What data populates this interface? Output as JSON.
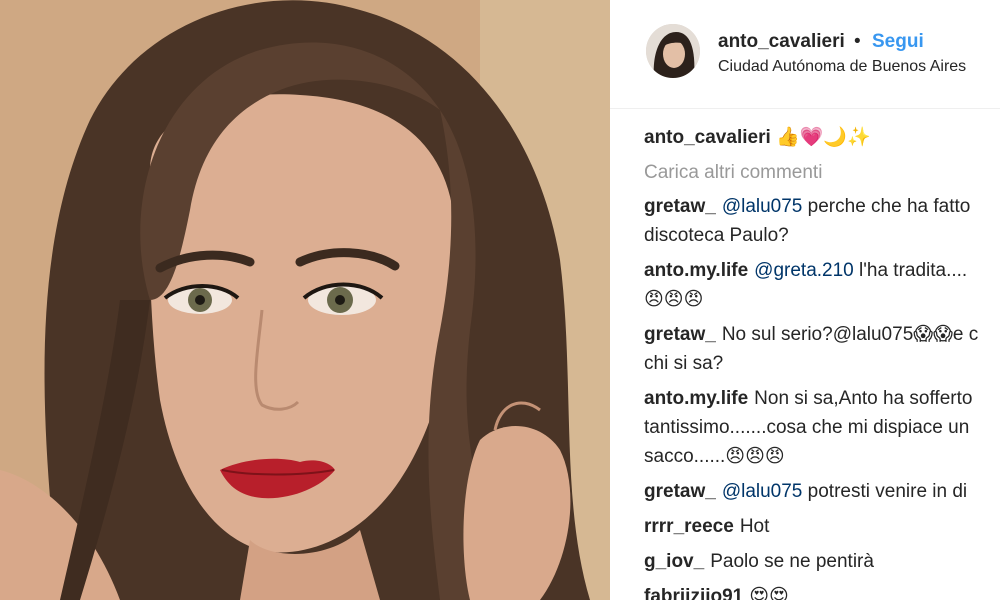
{
  "post": {
    "username": "anto_cavalieri",
    "separator": "•",
    "follow_label": "Segui",
    "location": "Ciudad Autónoma de Buenos Aires"
  },
  "caption": {
    "username": "anto_cavalieri",
    "text": "👍💗🌙✨"
  },
  "load_more_label": "Carica altri commenti",
  "comments": [
    {
      "username": "gretaw_",
      "mention": "@lalu075",
      "lines": [
        "perche che ha fatto",
        "discoteca Paulo?"
      ]
    },
    {
      "username": "anto.my.life",
      "mention": "@greta.210",
      "lines": [
        "l'ha tradita....",
        "😠😠😠"
      ]
    },
    {
      "username": "gretaw_",
      "mention": "",
      "lines": [
        "No sul serio?@lalu075😱😱e c",
        "chi si sa?"
      ]
    },
    {
      "username": "anto.my.life",
      "mention": "",
      "lines": [
        "Non si sa,Anto ha sofferto",
        "tantissimo.......cosa che mi dispiace un",
        "sacco......😠😠😠"
      ]
    },
    {
      "username": "gretaw_",
      "mention": "@lalu075",
      "lines": [
        "potresti venire in di"
      ]
    },
    {
      "username": "rrrr_reece",
      "mention": "",
      "lines": [
        "Hot"
      ]
    },
    {
      "username": "g_iov_",
      "mention": "",
      "lines": [
        "Paolo se ne pentirà"
      ]
    },
    {
      "username": "fabriiziio91",
      "mention": "",
      "lines": [
        "😍😍"
      ]
    }
  ],
  "photo": {
    "description_icon": "portrait-photo"
  }
}
